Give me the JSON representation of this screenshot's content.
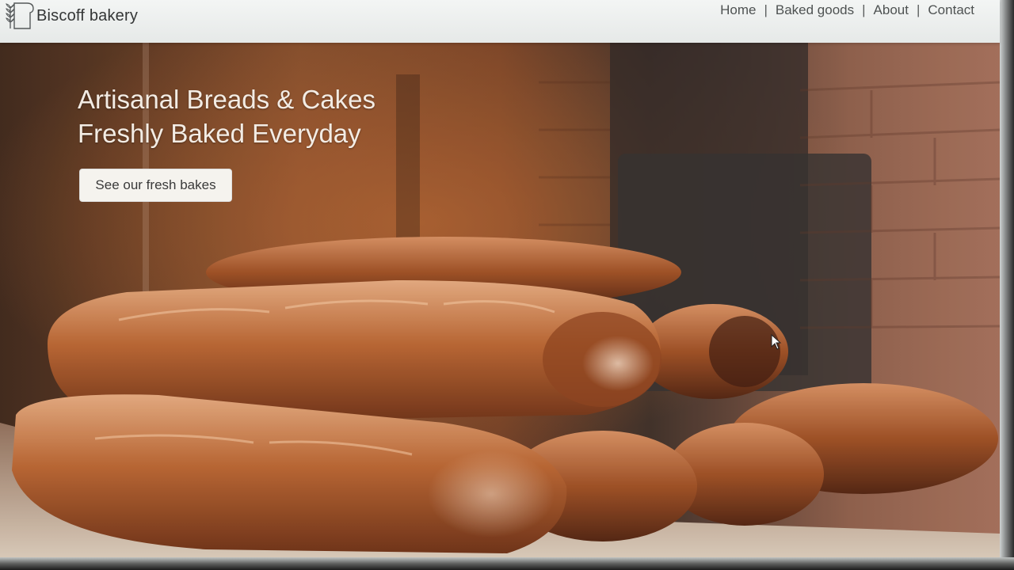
{
  "navbar": {
    "brand_name": "Biscoff bakery",
    "brand_logo": "wheat-bread-icon",
    "links": [
      "Home",
      "Baked goods",
      "About",
      "Contact"
    ],
    "separator": "|"
  },
  "hero": {
    "title_line1": "Artisanal Breads & Cakes",
    "title_line2": "Freshly Baked Everyday",
    "cta_label": "See our fresh bakes",
    "background": "baguettes-photo"
  },
  "colors": {
    "navbar_bg": "#e9ebe9",
    "hero_text": "#f3ece4",
    "button_bg": "#f5f3ee"
  }
}
